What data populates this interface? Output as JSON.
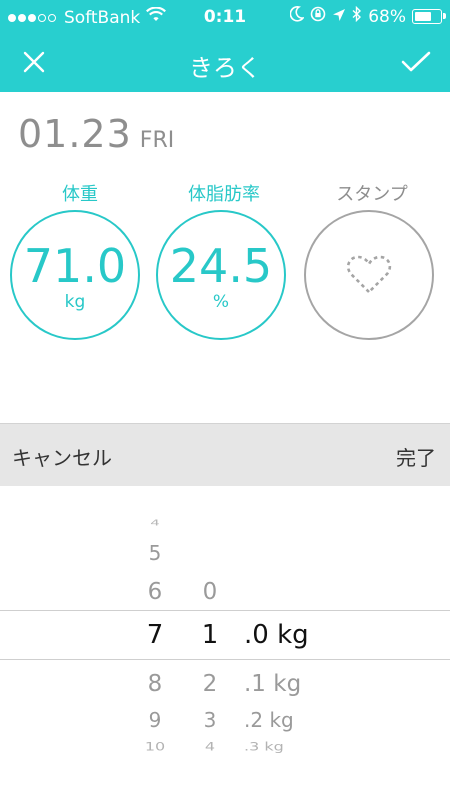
{
  "status_bar": {
    "signal_dots": 5,
    "signal_filled": 3,
    "carrier": "SoftBank",
    "time": "0:11",
    "battery": "68%",
    "icons": [
      "wifi-icon",
      "moon-icon",
      "rotation-lock-icon",
      "location-arrow-icon",
      "bluetooth-icon",
      "battery-icon"
    ]
  },
  "nav": {
    "title": "きろく",
    "close_icon": "close-icon",
    "check_icon": "checkmark-icon"
  },
  "date": {
    "number": "01.23",
    "day": "FRI"
  },
  "metrics": {
    "weight": {
      "label": "体重",
      "value": "71.0",
      "unit": "kg"
    },
    "body_fat": {
      "label": "体脂肪率",
      "value": "24.5",
      "unit": "%"
    },
    "stamp": {
      "label": "スタンプ",
      "icon": "heart-outline-icon"
    }
  },
  "toolbar": {
    "cancel": "キャンセル",
    "done": "完了"
  },
  "picker": {
    "col_a": [
      "4",
      "5",
      "6",
      "7",
      "8",
      "9",
      "10"
    ],
    "col_b": [
      "0",
      "1",
      "2",
      "3",
      "4"
    ],
    "col_c": [
      ".0 kg",
      ".1 kg",
      ".2 kg",
      ".3 kg"
    ],
    "selected": {
      "col_a": "7",
      "col_b": "1",
      "col_c": ".0 kg"
    }
  },
  "colors": {
    "accent": "#28cfcf",
    "gray": "#8e8e8e",
    "toolbar_bg": "#e6e6e6"
  }
}
